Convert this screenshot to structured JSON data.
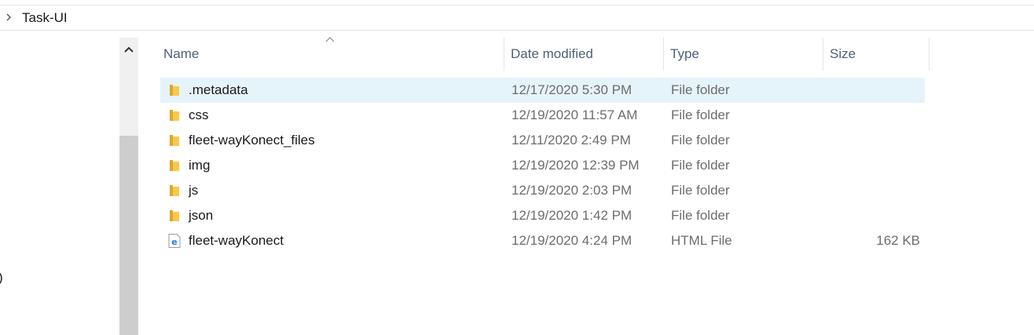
{
  "breadcrumb": {
    "path": "Task-UI"
  },
  "left_pane": {
    "clipped_text": ")"
  },
  "columns": {
    "name": "Name",
    "date_modified": "Date modified",
    "type": "Type",
    "size": "Size"
  },
  "files": [
    {
      "name": ".metadata",
      "date": "12/17/2020 5:30 PM",
      "type": "File folder",
      "size": "",
      "icon": "folder-icon",
      "selected": true
    },
    {
      "name": "css",
      "date": "12/19/2020 11:57 AM",
      "type": "File folder",
      "size": "",
      "icon": "folder-icon",
      "selected": false
    },
    {
      "name": "fleet-wayKonect_files",
      "date": "12/11/2020 2:49 PM",
      "type": "File folder",
      "size": "",
      "icon": "folder-icon",
      "selected": false
    },
    {
      "name": "img",
      "date": "12/19/2020 12:39 PM",
      "type": "File folder",
      "size": "",
      "icon": "folder-icon",
      "selected": false
    },
    {
      "name": "js",
      "date": "12/19/2020 2:03 PM",
      "type": "File folder",
      "size": "",
      "icon": "folder-icon",
      "selected": false
    },
    {
      "name": "json",
      "date": "12/19/2020 1:42 PM",
      "type": "File folder",
      "size": "",
      "icon": "folder-icon",
      "selected": false
    },
    {
      "name": "fleet-wayKonect",
      "date": "12/19/2020 4:24 PM",
      "type": "HTML File",
      "size": "162 KB",
      "icon": "edge-html-file-icon",
      "selected": false
    }
  ],
  "colors": {
    "selection": "#e5f3fb",
    "header_text": "#4c607a",
    "folder": "#f5c852",
    "edge_blue": "#1e7bd4"
  }
}
